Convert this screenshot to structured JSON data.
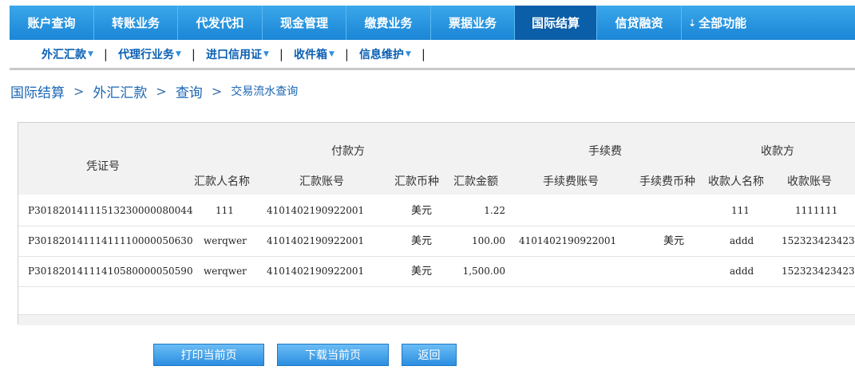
{
  "top_nav": {
    "items": [
      "账户查询",
      "转账业务",
      "代发代扣",
      "现金管理",
      "缴费业务",
      "票据业务",
      "国际结算",
      "信贷融资"
    ],
    "all_functions": "全部功能",
    "active": "国际结算"
  },
  "sub_nav": {
    "items": [
      "外汇汇款",
      "代理行业务",
      "进口信用证",
      "收件箱",
      "信息维护"
    ]
  },
  "breadcrumb": {
    "items": [
      "国际结算",
      "外汇汇款",
      "查询",
      "交易流水查询"
    ]
  },
  "table": {
    "group_headers": {
      "payer": "付款方",
      "fee": "手续费",
      "payee": "收款方"
    },
    "voucher_header": "凭证号",
    "columns": [
      "汇款人名称",
      "汇款账号",
      "汇款币种",
      "汇款金额",
      "手续费账号",
      "手续费币种",
      "收款人名称",
      "收款账号"
    ],
    "rows": [
      {
        "voucher": "P30182014111513230000080044",
        "remitter": "111",
        "account": "4101402190922001",
        "currency": "美元",
        "amount": "1.22",
        "fee_account": "",
        "fee_currency": "",
        "payee_name": "111",
        "payee_account": "1111111"
      },
      {
        "voucher": "P30182014111411110000050630",
        "remitter": "werqwer",
        "account": "4101402190922001",
        "currency": "美元",
        "amount": "100.00",
        "fee_account": "4101402190922001",
        "fee_currency": "美元",
        "payee_name": "addd",
        "payee_account": "152323423423"
      },
      {
        "voucher": "P30182014111410580000050590",
        "remitter": "werqwer",
        "account": "4101402190922001",
        "currency": "美元",
        "amount": "1,500.00",
        "fee_account": "",
        "fee_currency": "",
        "payee_name": "addd",
        "payee_account": "152323423423"
      }
    ]
  },
  "buttons": {
    "print": "打印当前页",
    "download": "下载当前页",
    "back": "返回"
  }
}
